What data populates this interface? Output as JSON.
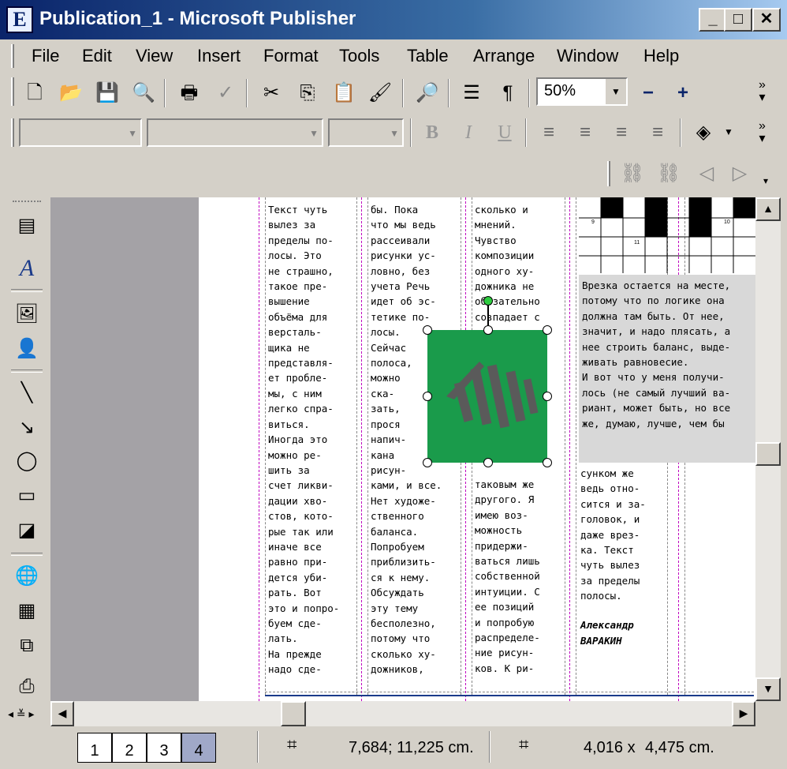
{
  "window": {
    "app_icon": "E",
    "title": "Publication_1 - Microsoft Publisher",
    "minimize": "_",
    "maximize": "□",
    "close": "✕"
  },
  "menu": [
    "File",
    "Edit",
    "View",
    "Insert",
    "Format",
    "Tools",
    "Table",
    "Arrange",
    "Window",
    "Help"
  ],
  "toolbar": {
    "icons": [
      "new-icon",
      "open-icon",
      "save-icon",
      "print-preview-icon",
      "print-icon",
      "spelling-icon",
      "cut-icon",
      "copy-icon",
      "paste-icon",
      "format-painter-icon",
      "zoom-page-icon",
      "columns-icon",
      "paragraph-icon"
    ],
    "zoom_value": "50%",
    "zoom_out": "−",
    "zoom_in": "+"
  },
  "format_toolbar": {
    "font_name": "",
    "font_family": "",
    "font_size": "",
    "bold": "B",
    "italic": "I",
    "underline": "U"
  },
  "document": {
    "col1": [
      "Текст чуть",
      "вылез за",
      "пределы по-",
      "лосы. Это",
      "не страшно,",
      "такое пре-",
      "вышение",
      "объёма для",
      "версталь-",
      "щика не",
      "представля-",
      "ет пробле-",
      "мы, с ним",
      "легко спра-",
      "виться.",
      "Иногда это",
      "можно ре-",
      "шить за",
      "счет ликви-",
      "дации хво-",
      "стов, кото-",
      "рые так или",
      "иначе все",
      "равно при-",
      "дется уби-",
      "рать. Вот",
      "это и попро-",
      "буем сде-",
      "лать.",
      "На прежде",
      "надо сде-"
    ],
    "col2": [
      "бы. Пока",
      "что мы ведь",
      "рассеивали",
      "рисунки ус-",
      "ловно, без",
      "учета Речь",
      "идет об эс-",
      "тетике по-",
      "лосы.",
      "Сейчас",
      "полоса,",
      "можно",
      "ска-",
      "зать,",
      "прося",
      "напич-",
      "кана",
      "рисун-",
      "ками, и все.",
      "Нет художе-",
      "ственного",
      "баланса.",
      "Попробуем",
      "приблизить-",
      "ся к нему.",
      "Обсуждать",
      "эту тему",
      "бесполезно,",
      "потому что",
      "сколько ху-",
      "дожников,"
    ],
    "col3_top": [
      "сколько и",
      "мнений.",
      "Чувство",
      "композиции",
      "одного ху-",
      "дожника не",
      "обязательно",
      "совпадает с"
    ],
    "col3_bottom": [
      "таковым же",
      "другого. Я",
      "имею воз-",
      "можность",
      "придержи-",
      "ваться лишь",
      "собственной",
      "интуиции. С",
      "ее позиций",
      "и попробую",
      "распределе-",
      "ние рисун-",
      "ков. К ри-"
    ],
    "sidebar": [
      "Врезка остается на месте,",
      "потому что по логике она",
      "должна там быть. От нее,",
      "значит, и надо плясать, а",
      "нее строить баланс, выде-",
      "живать равновесие.",
      "",
      "И вот что у меня получи-",
      "лось (не самый лучший ва-",
      "риант, может быть, но все",
      "же, думаю, лучше, чем бы"
    ],
    "col4_bottom": [
      "сунком же",
      "ведь отно-",
      "сится и за-",
      "головок, и",
      "даже врез-",
      "ка. Текст",
      "чуть вылез",
      "за пределы",
      "полосы."
    ],
    "author_first": "Александр",
    "author_last": "ВАРАКИН",
    "crossword_numbers": [
      "9",
      "10",
      "11"
    ]
  },
  "status": {
    "pages": [
      "1",
      "2",
      "3",
      "4"
    ],
    "active_page": "4",
    "position": "7,684; 11,225 cm.",
    "size_w": "4,016 x",
    "size_h": "4,475 cm."
  }
}
